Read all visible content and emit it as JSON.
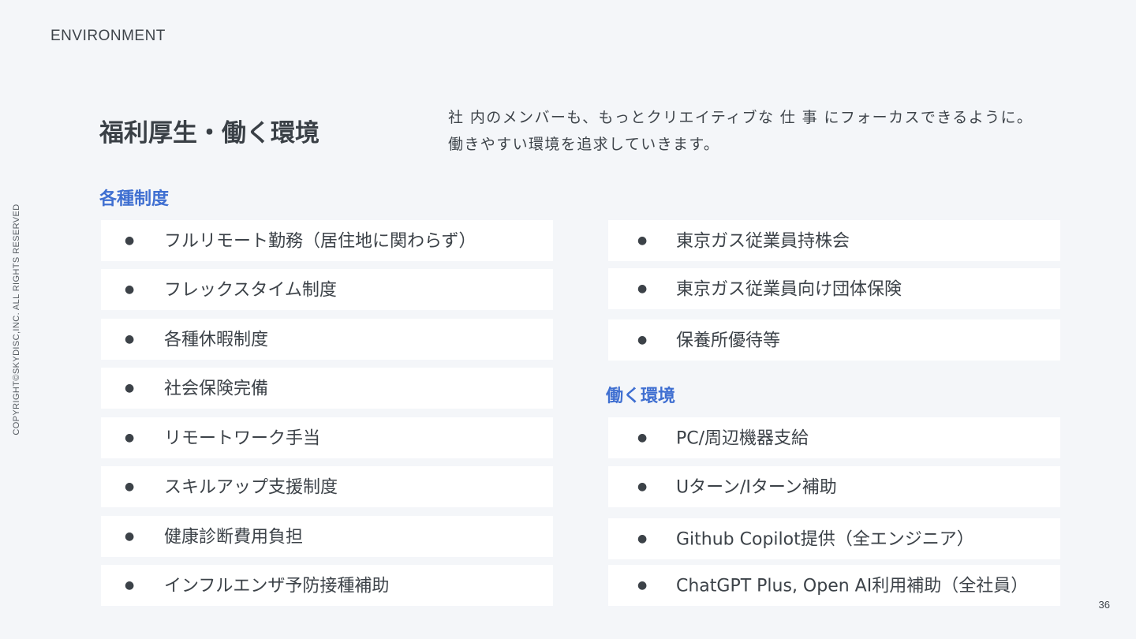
{
  "header": {
    "section_label": "ENVIRONMENT"
  },
  "sidebar": {
    "copyright": "COPYRIGHT©SKYDISC,INC. ALL RIGHTS RESERVED"
  },
  "footer": {
    "page_number": "36"
  },
  "title": "福利厚生・働く環境",
  "intro": {
    "line1": "社 内のメンバーも、もっとクリエイティブな 仕 事 にフォーカスできるように。",
    "line2": "働きやすい環境を追求していきます。"
  },
  "bullet_glyph": "●",
  "sections": {
    "systems": {
      "heading": "各種制度",
      "left_items": [
        "フルリモート勤務（居住地に関わらず）",
        "フレックスタイム制度",
        "各種休暇制度",
        "社会保険完備",
        "リモートワーク手当",
        "スキルアップ支援制度",
        "健康診断費用負担",
        "インフルエンザ予防接種補助"
      ],
      "right_items": [
        "東京ガス従業員持株会",
        "東京ガス従業員向け団体保険",
        "保養所優待等"
      ]
    },
    "environment": {
      "heading": "働く環境",
      "items": [
        "PC/周辺機器支給",
        "Uターン/Iターン補助",
        "Github Copilot提供（全エンジニア）",
        "ChatGPT Plus, Open AI利用補助（全社員）"
      ]
    }
  }
}
